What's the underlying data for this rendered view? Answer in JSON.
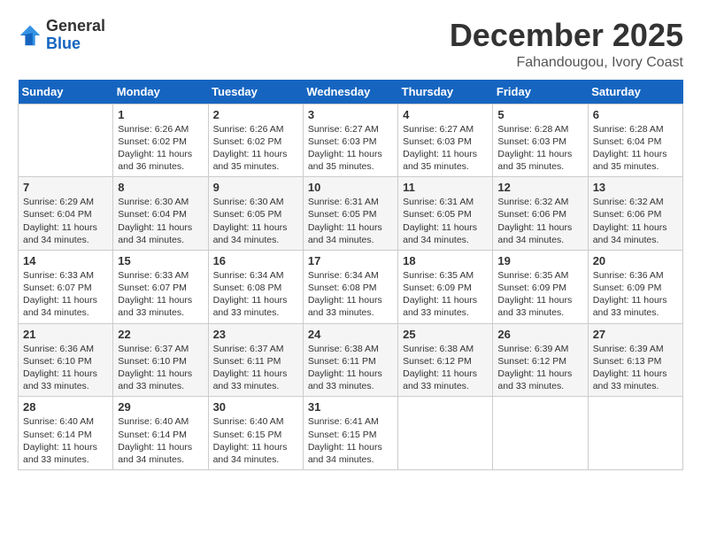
{
  "header": {
    "logo_general": "General",
    "logo_blue": "Blue",
    "month_year": "December 2025",
    "location": "Fahandougou, Ivory Coast"
  },
  "weekdays": [
    "Sunday",
    "Monday",
    "Tuesday",
    "Wednesday",
    "Thursday",
    "Friday",
    "Saturday"
  ],
  "weeks": [
    [
      {
        "day": "",
        "sunrise": "",
        "sunset": "",
        "daylight": ""
      },
      {
        "day": "1",
        "sunrise": "Sunrise: 6:26 AM",
        "sunset": "Sunset: 6:02 PM",
        "daylight": "Daylight: 11 hours and 36 minutes."
      },
      {
        "day": "2",
        "sunrise": "Sunrise: 6:26 AM",
        "sunset": "Sunset: 6:02 PM",
        "daylight": "Daylight: 11 hours and 35 minutes."
      },
      {
        "day": "3",
        "sunrise": "Sunrise: 6:27 AM",
        "sunset": "Sunset: 6:03 PM",
        "daylight": "Daylight: 11 hours and 35 minutes."
      },
      {
        "day": "4",
        "sunrise": "Sunrise: 6:27 AM",
        "sunset": "Sunset: 6:03 PM",
        "daylight": "Daylight: 11 hours and 35 minutes."
      },
      {
        "day": "5",
        "sunrise": "Sunrise: 6:28 AM",
        "sunset": "Sunset: 6:03 PM",
        "daylight": "Daylight: 11 hours and 35 minutes."
      },
      {
        "day": "6",
        "sunrise": "Sunrise: 6:28 AM",
        "sunset": "Sunset: 6:04 PM",
        "daylight": "Daylight: 11 hours and 35 minutes."
      }
    ],
    [
      {
        "day": "7",
        "sunrise": "Sunrise: 6:29 AM",
        "sunset": "Sunset: 6:04 PM",
        "daylight": "Daylight: 11 hours and 34 minutes."
      },
      {
        "day": "8",
        "sunrise": "Sunrise: 6:30 AM",
        "sunset": "Sunset: 6:04 PM",
        "daylight": "Daylight: 11 hours and 34 minutes."
      },
      {
        "day": "9",
        "sunrise": "Sunrise: 6:30 AM",
        "sunset": "Sunset: 6:05 PM",
        "daylight": "Daylight: 11 hours and 34 minutes."
      },
      {
        "day": "10",
        "sunrise": "Sunrise: 6:31 AM",
        "sunset": "Sunset: 6:05 PM",
        "daylight": "Daylight: 11 hours and 34 minutes."
      },
      {
        "day": "11",
        "sunrise": "Sunrise: 6:31 AM",
        "sunset": "Sunset: 6:05 PM",
        "daylight": "Daylight: 11 hours and 34 minutes."
      },
      {
        "day": "12",
        "sunrise": "Sunrise: 6:32 AM",
        "sunset": "Sunset: 6:06 PM",
        "daylight": "Daylight: 11 hours and 34 minutes."
      },
      {
        "day": "13",
        "sunrise": "Sunrise: 6:32 AM",
        "sunset": "Sunset: 6:06 PM",
        "daylight": "Daylight: 11 hours and 34 minutes."
      }
    ],
    [
      {
        "day": "14",
        "sunrise": "Sunrise: 6:33 AM",
        "sunset": "Sunset: 6:07 PM",
        "daylight": "Daylight: 11 hours and 34 minutes."
      },
      {
        "day": "15",
        "sunrise": "Sunrise: 6:33 AM",
        "sunset": "Sunset: 6:07 PM",
        "daylight": "Daylight: 11 hours and 33 minutes."
      },
      {
        "day": "16",
        "sunrise": "Sunrise: 6:34 AM",
        "sunset": "Sunset: 6:08 PM",
        "daylight": "Daylight: 11 hours and 33 minutes."
      },
      {
        "day": "17",
        "sunrise": "Sunrise: 6:34 AM",
        "sunset": "Sunset: 6:08 PM",
        "daylight": "Daylight: 11 hours and 33 minutes."
      },
      {
        "day": "18",
        "sunrise": "Sunrise: 6:35 AM",
        "sunset": "Sunset: 6:09 PM",
        "daylight": "Daylight: 11 hours and 33 minutes."
      },
      {
        "day": "19",
        "sunrise": "Sunrise: 6:35 AM",
        "sunset": "Sunset: 6:09 PM",
        "daylight": "Daylight: 11 hours and 33 minutes."
      },
      {
        "day": "20",
        "sunrise": "Sunrise: 6:36 AM",
        "sunset": "Sunset: 6:09 PM",
        "daylight": "Daylight: 11 hours and 33 minutes."
      }
    ],
    [
      {
        "day": "21",
        "sunrise": "Sunrise: 6:36 AM",
        "sunset": "Sunset: 6:10 PM",
        "daylight": "Daylight: 11 hours and 33 minutes."
      },
      {
        "day": "22",
        "sunrise": "Sunrise: 6:37 AM",
        "sunset": "Sunset: 6:10 PM",
        "daylight": "Daylight: 11 hours and 33 minutes."
      },
      {
        "day": "23",
        "sunrise": "Sunrise: 6:37 AM",
        "sunset": "Sunset: 6:11 PM",
        "daylight": "Daylight: 11 hours and 33 minutes."
      },
      {
        "day": "24",
        "sunrise": "Sunrise: 6:38 AM",
        "sunset": "Sunset: 6:11 PM",
        "daylight": "Daylight: 11 hours and 33 minutes."
      },
      {
        "day": "25",
        "sunrise": "Sunrise: 6:38 AM",
        "sunset": "Sunset: 6:12 PM",
        "daylight": "Daylight: 11 hours and 33 minutes."
      },
      {
        "day": "26",
        "sunrise": "Sunrise: 6:39 AM",
        "sunset": "Sunset: 6:12 PM",
        "daylight": "Daylight: 11 hours and 33 minutes."
      },
      {
        "day": "27",
        "sunrise": "Sunrise: 6:39 AM",
        "sunset": "Sunset: 6:13 PM",
        "daylight": "Daylight: 11 hours and 33 minutes."
      }
    ],
    [
      {
        "day": "28",
        "sunrise": "Sunrise: 6:40 AM",
        "sunset": "Sunset: 6:14 PM",
        "daylight": "Daylight: 11 hours and 33 minutes."
      },
      {
        "day": "29",
        "sunrise": "Sunrise: 6:40 AM",
        "sunset": "Sunset: 6:14 PM",
        "daylight": "Daylight: 11 hours and 34 minutes."
      },
      {
        "day": "30",
        "sunrise": "Sunrise: 6:40 AM",
        "sunset": "Sunset: 6:15 PM",
        "daylight": "Daylight: 11 hours and 34 minutes."
      },
      {
        "day": "31",
        "sunrise": "Sunrise: 6:41 AM",
        "sunset": "Sunset: 6:15 PM",
        "daylight": "Daylight: 11 hours and 34 minutes."
      },
      {
        "day": "",
        "sunrise": "",
        "sunset": "",
        "daylight": ""
      },
      {
        "day": "",
        "sunrise": "",
        "sunset": "",
        "daylight": ""
      },
      {
        "day": "",
        "sunrise": "",
        "sunset": "",
        "daylight": ""
      }
    ]
  ]
}
